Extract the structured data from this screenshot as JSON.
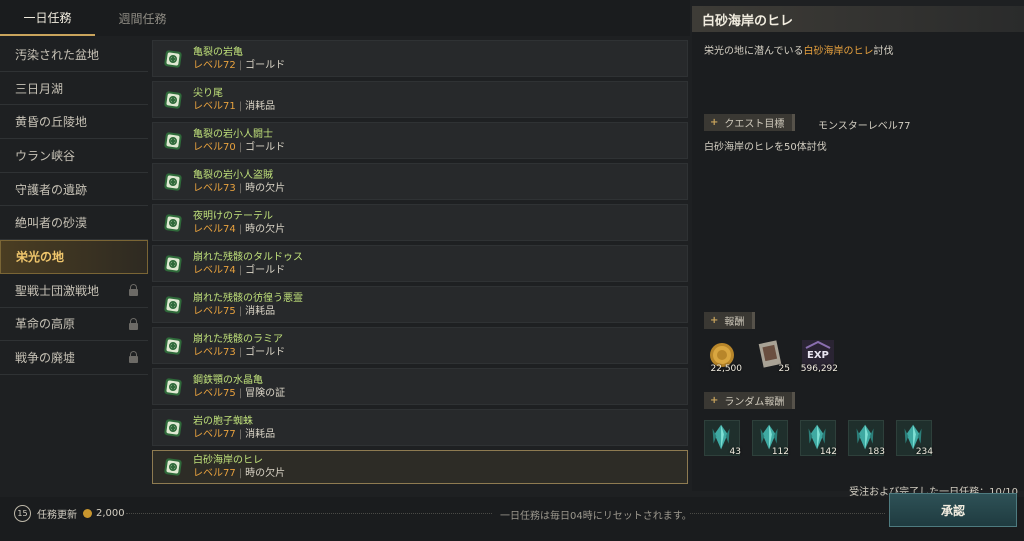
{
  "tabs": [
    {
      "label": "一日任務",
      "active": true
    },
    {
      "label": "週間任務",
      "active": false
    }
  ],
  "sidebar": {
    "items": [
      {
        "label": "汚染された盆地",
        "locked": false
      },
      {
        "label": "三日月湖",
        "locked": false
      },
      {
        "label": "黄昏の丘陵地",
        "locked": false
      },
      {
        "label": "ウラン峡谷",
        "locked": false
      },
      {
        "label": "守護者の遺跡",
        "locked": false
      },
      {
        "label": "絶叫者の砂漠",
        "locked": false
      },
      {
        "label": "栄光の地",
        "locked": false,
        "active": true
      },
      {
        "label": "聖戦士団激戦地",
        "locked": true
      },
      {
        "label": "革命の高原",
        "locked": true
      },
      {
        "label": "戦争の廃墟",
        "locked": true
      }
    ]
  },
  "quests": [
    {
      "name": "亀裂の岩亀",
      "level": "レベル72",
      "reward": "ゴールド"
    },
    {
      "name": "尖り尾",
      "level": "レベル71",
      "reward": "消耗品"
    },
    {
      "name": "亀裂の岩小人闘士",
      "level": "レベル70",
      "reward": "ゴールド"
    },
    {
      "name": "亀裂の岩小人盗賊",
      "level": "レベル73",
      "reward": "時の欠片"
    },
    {
      "name": "夜明けのテーテル",
      "level": "レベル74",
      "reward": "時の欠片"
    },
    {
      "name": "崩れた残骸のタルドゥス",
      "level": "レベル74",
      "reward": "ゴールド"
    },
    {
      "name": "崩れた残骸の彷徨う悪霊",
      "level": "レベル75",
      "reward": "消耗品"
    },
    {
      "name": "崩れた残骸のラミア",
      "level": "レベル73",
      "reward": "ゴールド"
    },
    {
      "name": "鋼鉄顎の水晶亀",
      "level": "レベル75",
      "reward": "冒険の証"
    },
    {
      "name": "岩の胞子蜘蛛",
      "level": "レベル77",
      "reward": "消耗品"
    },
    {
      "name": "白砂海岸のヒレ",
      "level": "レベル77",
      "reward": "時の欠片",
      "selected": true
    }
  ],
  "detail": {
    "title": "白砂海岸のヒレ",
    "desc_prefix": "栄光の地に潜んでいる",
    "desc_highlight": "白砂海岸のヒレ",
    "desc_suffix": "討伐",
    "objective_label": "クエスト目標",
    "monster_level": "モンスターレベル77",
    "objective_text": "白砂海岸のヒレを50体討伐",
    "reward_label": "報酬",
    "rewards": [
      {
        "icon": "gold-coin-icon",
        "count": "22,500"
      },
      {
        "icon": "scroll-card-icon",
        "count": "25"
      },
      {
        "icon": "exp-icon",
        "label": "EXP",
        "count": "596,292"
      }
    ],
    "random_reward_label": "ランダム報酬",
    "random_rewards": [
      {
        "icon": "crystal-shard-icon",
        "count": "43"
      },
      {
        "icon": "crystal-shard-icon",
        "count": "112"
      },
      {
        "icon": "crystal-shard-icon",
        "count": "142"
      },
      {
        "icon": "crystal-shard-icon",
        "count": "183"
      },
      {
        "icon": "crystal-shard-icon",
        "count": "234"
      }
    ]
  },
  "footer": {
    "refresh_badge": "15",
    "refresh_label": "任務更新",
    "refresh_cost": "2,000",
    "reset_note": "一日任務は毎日04時にリセットされます。",
    "completed": "受注および完了した一日任務：10/10",
    "accept_label": "承認"
  },
  "colors": {
    "accent_gold": "#e7a13e",
    "quest_name": "#bfe07a",
    "button_teal": "#2e5156"
  }
}
